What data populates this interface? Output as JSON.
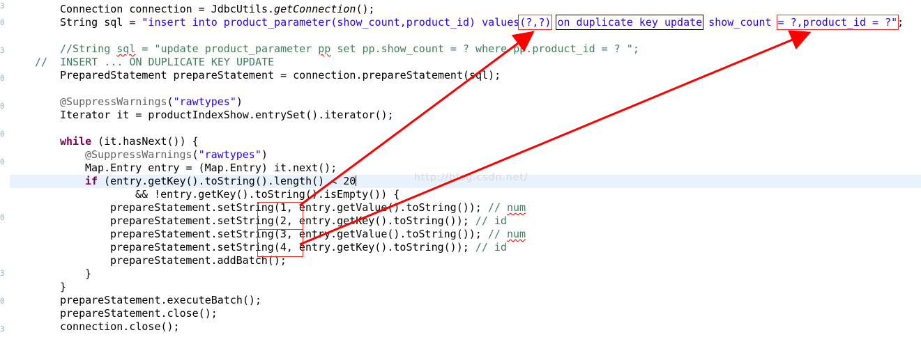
{
  "gutter_marks": [
    "3",
    "0",
    "3",
    "0",
    "0",
    "0",
    "0",
    "0",
    "3",
    "0",
    "3"
  ],
  "code": {
    "l1": {
      "a": "Connection connection = JdbcUtils.",
      "b": "getConnection",
      "c": "();"
    },
    "l2": {
      "a": "String sql = ",
      "b": "\"insert into product_parameter(show_count,product_id) values",
      "c": "(?,?)",
      "d": " ",
      "e": "on duplicate key update",
      "f": " show_count ",
      "g": "= ?,product_id = ?\"",
      "h": ";"
    },
    "l4": {
      "a": "//String ",
      "b": "sql",
      "c": " = \"update product_parameter ",
      "d": "pp",
      "e": " set pp.show_count = ? where pp.product_id = ? \";"
    },
    "l5": {
      "a": "//  INSERT ... ON DUPLICATE KEY UPDATE"
    },
    "l6": {
      "a": "PreparedStatement prepareStatement = connection.prepareStatement(sql);"
    },
    "l8": {
      "a": "@SuppressWarnings",
      "b": "(",
      "c": "\"rawtypes\"",
      "d": ")"
    },
    "l9": {
      "a": "Iterator it = productIndexShow.entrySet().iterator();"
    },
    "l11": {
      "a": "while",
      "b": " (it.hasNext()) {"
    },
    "l12": {
      "a": "@SuppressWarnings",
      "b": "(",
      "c": "\"rawtypes\"",
      "d": ")"
    },
    "l13": {
      "a": "Map.Entry entry = (Map.Entry) it.next();"
    },
    "l14": {
      "a": "if",
      "b": " (entry.getKey().toString().length() < 20"
    },
    "l15": {
      "a": "&& !entry.getKey().toString().isEmpty()) {"
    },
    "l16": {
      "a": "prepareStatement.setString(1, entry.getValue().toString()); ",
      "b": "// ",
      "c": "num"
    },
    "l17": {
      "a": "prepareStatement.setString(2, entry.getKey().toString()); ",
      "b": "// id"
    },
    "l18": {
      "a": "prepareStatement.setString(3, entry.getValue().toString()); ",
      "b": "// ",
      "c": "num"
    },
    "l19": {
      "a": "prepareStatement.setString(4, entry.getKey().toString()); ",
      "b": "// id"
    },
    "l20": {
      "a": "prepareStatement.addBatch();"
    },
    "l21": {
      "a": "}"
    },
    "l22": {
      "a": "}"
    },
    "l23": {
      "a": "prepareStatement.executeBatch();"
    },
    "l24": {
      "a": "prepareStatement.close();"
    },
    "l25": {
      "a": "connection.close();"
    }
  },
  "watermark": "http://blog.csdn.net/",
  "colors": {
    "keyword": "#7f0055",
    "string": "#2a00ff",
    "comment": "#3f7f5f",
    "annotation": "#646464",
    "highlight_box": "#e8302c",
    "arrow": "#ff0000",
    "current_line": "#e8f2fe"
  }
}
